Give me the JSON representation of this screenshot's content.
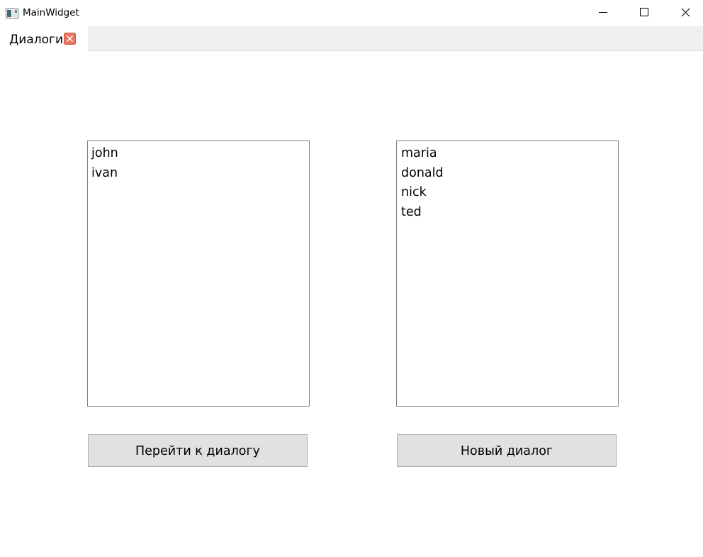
{
  "window": {
    "title": "MainWidget",
    "icon": "app-window-icon",
    "controls": [
      "minimize-icon",
      "maximize-icon",
      "close-icon"
    ]
  },
  "tabs": [
    {
      "label": "Диалоги",
      "closable": true,
      "active": true
    }
  ],
  "dialogs_list": {
    "items": [
      "john",
      "ivan"
    ]
  },
  "contacts_list": {
    "items": [
      "maria",
      "donald",
      "nick",
      "ted"
    ]
  },
  "buttons": {
    "open_dialog": "Перейти к диалогу",
    "new_dialog": "Новый диалог"
  },
  "colors": {
    "tab_close_bg": "#e8765c",
    "button_bg": "#e1e1e1",
    "tabbar_bg": "#f0f0f0"
  }
}
